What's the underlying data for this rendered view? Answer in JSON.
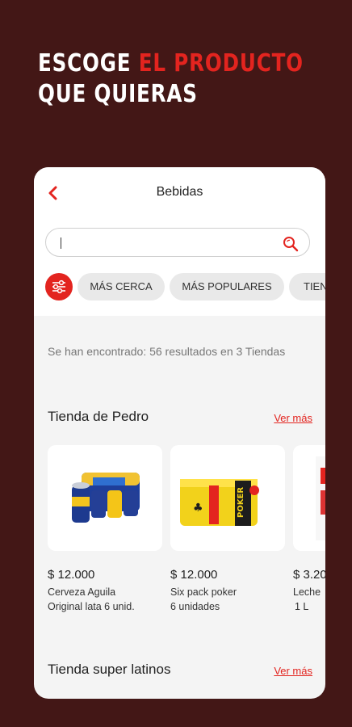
{
  "headline": {
    "line1_white": "ESCOGE",
    "line1_red": "EL PRODUCTO",
    "line2": "QUE QUIERAS"
  },
  "screen": {
    "title": "Bebidas",
    "search": {
      "value": "",
      "placeholder": ""
    },
    "chips": [
      "MÁS CERCA",
      "MÁS POPULARES",
      "TIEN"
    ],
    "results_text": "Se han encontrado: 56 resultados en  3 Tiendas",
    "stores": [
      {
        "name": "Tienda de Pedro",
        "see_more": "Ver más",
        "products": [
          {
            "price": "$ 12.000",
            "name_line1": "Cerveza Aguila",
            "name_line2": "Original lata 6 unid."
          },
          {
            "price": "$ 12.000",
            "name_line1": "Six pack poker",
            "name_line2": "6 unidades"
          },
          {
            "price": "$ 3.20",
            "name_line1": "Leche",
            "name_line2": "1 L"
          }
        ]
      },
      {
        "name": "Tienda super latinos",
        "see_more": "Ver más"
      }
    ]
  },
  "colors": {
    "background": "#431716",
    "accent": "#e3241f",
    "chip": "#e9e9e9"
  },
  "icons": [
    "chevron-left-icon",
    "search-icon",
    "filter-sliders-icon"
  ]
}
